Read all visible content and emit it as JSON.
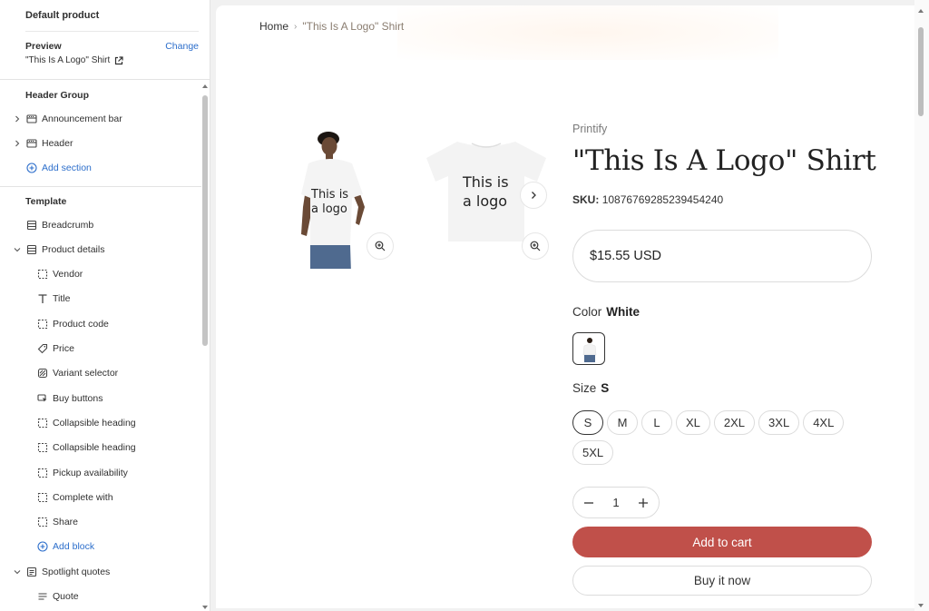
{
  "sidebar": {
    "title": "Default product",
    "preview_label": "Preview",
    "change_label": "Change",
    "preview_value": "\"This Is A Logo\" Shirt",
    "header_group_title": "Header Group",
    "header_items": [
      {
        "label": "Announcement bar",
        "icon": "section-icon"
      },
      {
        "label": "Header",
        "icon": "section-icon"
      }
    ],
    "add_section_label": "Add section",
    "template_title": "Template",
    "template_items": [
      {
        "label": "Breadcrumb",
        "icon": "section-icon"
      },
      {
        "label": "Product details",
        "icon": "section-icon"
      }
    ],
    "blocks": [
      {
        "label": "Vendor",
        "icon": "block-icon"
      },
      {
        "label": "Title",
        "icon": "text-icon"
      },
      {
        "label": "Product code",
        "icon": "block-icon"
      },
      {
        "label": "Price",
        "icon": "price-tag-icon"
      },
      {
        "label": "Variant selector",
        "icon": "variant-icon"
      },
      {
        "label": "Buy buttons",
        "icon": "cursor-icon"
      },
      {
        "label": "Collapsible heading",
        "icon": "block-icon"
      },
      {
        "label": "Collapsible heading",
        "icon": "block-icon"
      },
      {
        "label": "Pickup availability",
        "icon": "block-icon"
      },
      {
        "label": "Complete with",
        "icon": "block-icon"
      },
      {
        "label": "Share",
        "icon": "block-icon"
      }
    ],
    "add_block_label": "Add block",
    "spotlight_label": "Spotlight quotes",
    "quote_label": "Quote"
  },
  "preview": {
    "breadcrumb_home": "Home",
    "breadcrumb_current": "\"This Is A Logo\" Shirt",
    "image_text_1": "This is a logo",
    "image_text_2": "This is a logo",
    "vendor": "Printify",
    "title": "\"This Is A Logo\" Shirt",
    "sku_label": "SKU:",
    "sku_value": "10876769285239454240",
    "price": "$15.55 USD",
    "color_label": "Color",
    "color_value": "White",
    "size_label": "Size",
    "size_value": "S",
    "sizes": [
      "S",
      "M",
      "L",
      "XL",
      "2XL",
      "3XL",
      "4XL",
      "5XL"
    ],
    "quantity": "1",
    "add_to_cart": "Add to cart",
    "buy_now": "Buy it now"
  },
  "colors": {
    "accent_link": "#2c6ecb",
    "cart_button": "#c0504a"
  }
}
